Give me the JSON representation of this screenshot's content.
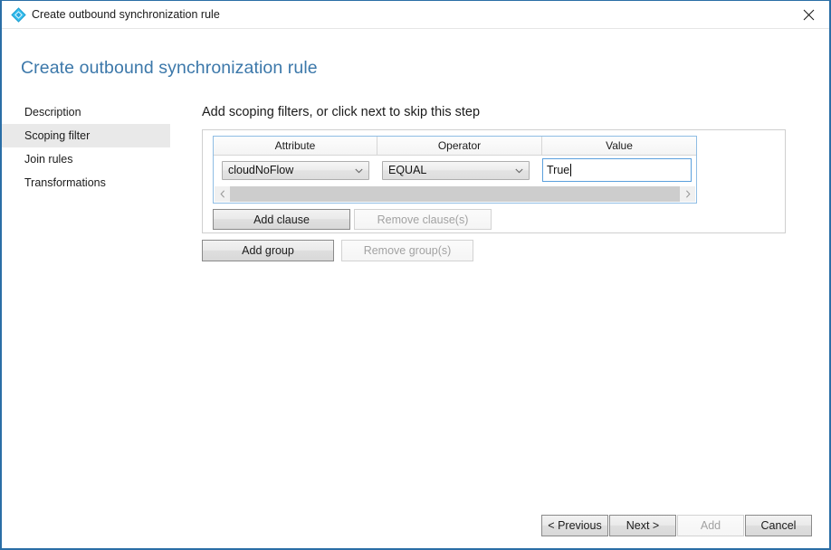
{
  "window": {
    "title": "Create outbound synchronization rule",
    "icon": "sync-rule-diamond-icon",
    "close_label": "✕",
    "accent_color": "#2a6ea6"
  },
  "header": {
    "title": "Create outbound synchronization rule",
    "color": "#3c78aa"
  },
  "sidebar": {
    "items": [
      {
        "label": "Description",
        "selected": false
      },
      {
        "label": "Scoping filter",
        "selected": true
      },
      {
        "label": "Join rules",
        "selected": false
      },
      {
        "label": "Transformations",
        "selected": false
      }
    ],
    "selected_background": "#e9e9e9"
  },
  "main": {
    "heading": "Add scoping filters, or click next to skip this step",
    "clause_table": {
      "columns": [
        "Attribute",
        "Operator",
        "Value"
      ],
      "rows": [
        {
          "attribute": "cloudNoFlow",
          "operator": "EQUAL",
          "value": "True"
        }
      ]
    },
    "scrollbar": {
      "left_arrow": "‹",
      "right_arrow": "›"
    },
    "clause_buttons": {
      "add": "Add clause",
      "remove": "Remove clause(s)",
      "remove_enabled": false
    },
    "group_buttons": {
      "add": "Add group",
      "remove": "Remove group(s)",
      "remove_enabled": false
    }
  },
  "footer": {
    "previous": "< Previous",
    "next": "Next >",
    "add": "Add",
    "add_enabled": false,
    "cancel": "Cancel"
  }
}
